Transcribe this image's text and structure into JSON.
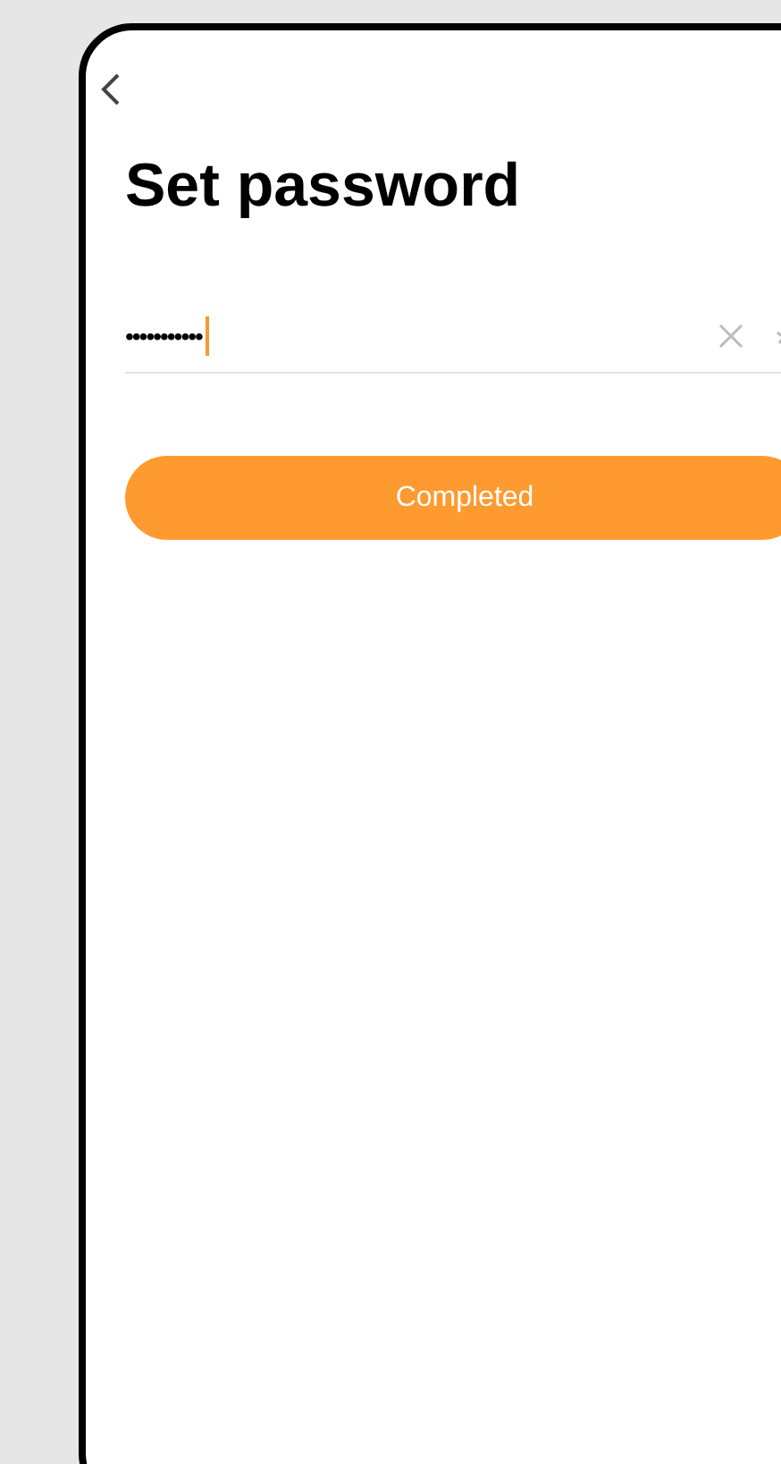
{
  "title": "Set password",
  "password_field": {
    "value": "•••••••••••",
    "focused": true
  },
  "buttons": [
    {
      "label": "Completed"
    }
  ]
}
